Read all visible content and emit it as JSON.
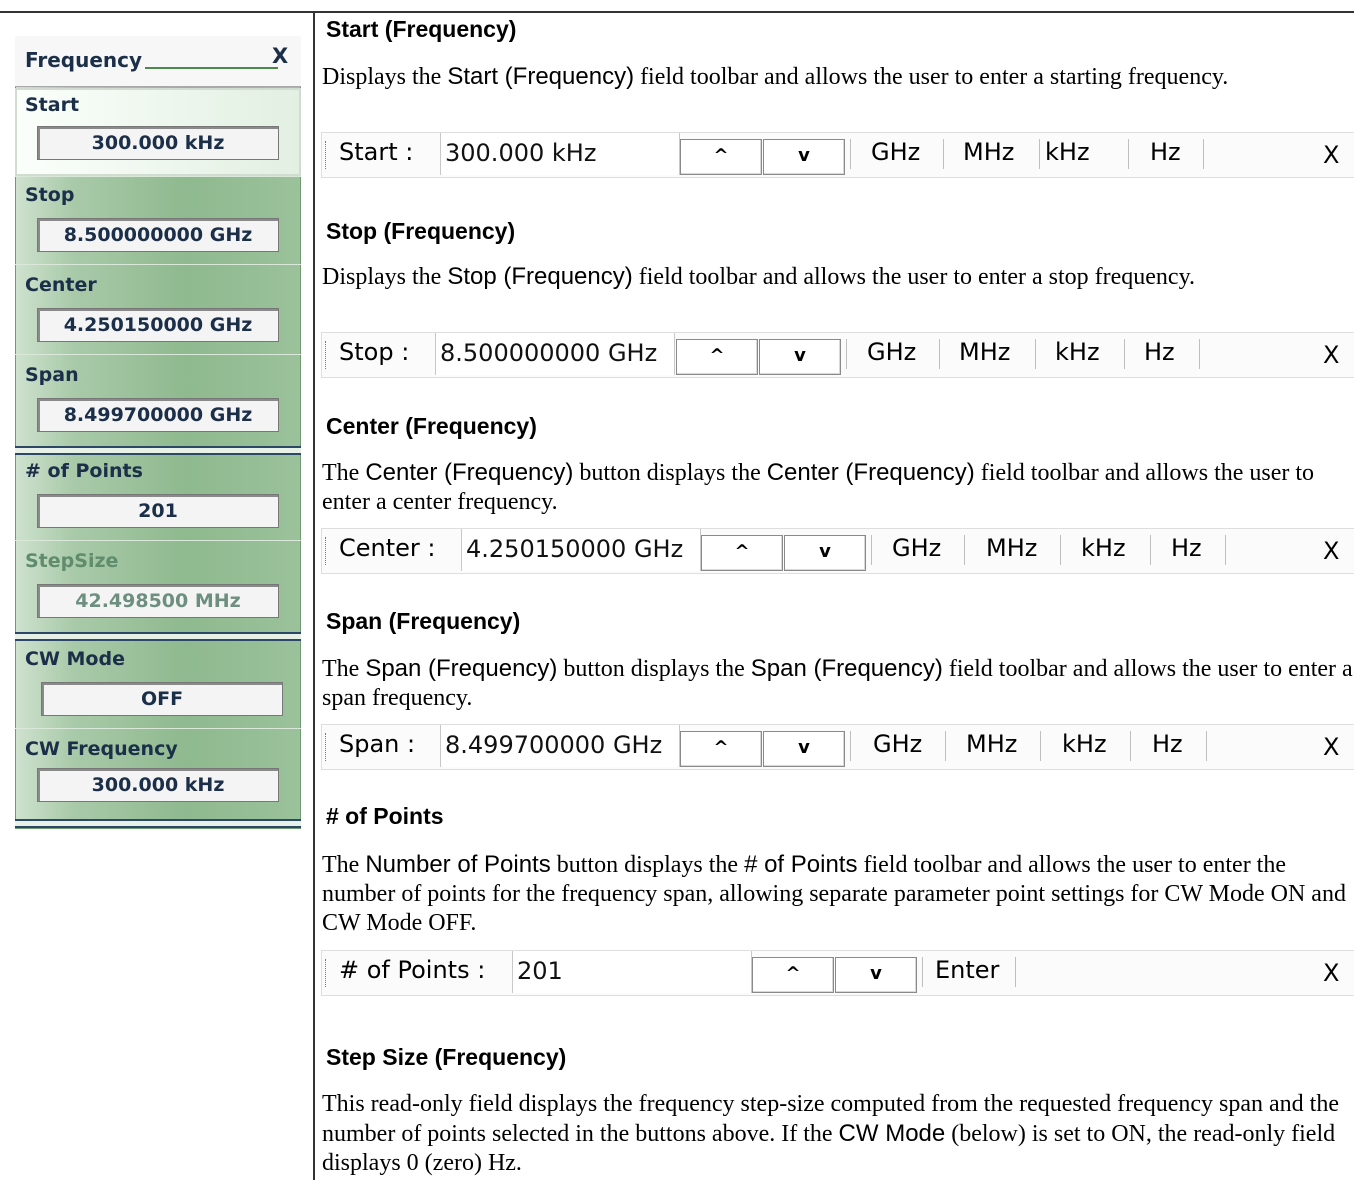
{
  "menu": {
    "title": "Frequency",
    "close_label": "X",
    "items": [
      {
        "label": "Start",
        "value": "300.000 kHz"
      },
      {
        "label": "Stop",
        "value": "8.500000000 GHz"
      },
      {
        "label": "Center",
        "value": "4.250150000 GHz"
      },
      {
        "label": "Span",
        "value": "8.499700000 GHz"
      },
      {
        "label": "# of Points",
        "value": "201"
      },
      {
        "label": "StepSize",
        "value": "42.498500 MHz"
      },
      {
        "label": "CW Mode",
        "value": "OFF"
      },
      {
        "label": "CW Frequency",
        "value": "300.000 kHz"
      }
    ]
  },
  "sections": {
    "start": {
      "heading": "Start (Frequency)",
      "p1": "Displays the ",
      "k1": "Start (Frequency)",
      "p2": " field toolbar and allows the user to enter a starting frequency."
    },
    "stop": {
      "heading": "Stop (Frequency)",
      "p1": "Displays the ",
      "k1": "Stop (Frequency)",
      "p2": " field toolbar and allows the user to enter a stop frequency."
    },
    "center": {
      "heading": "Center (Frequency)",
      "p1": "The ",
      "k1": "Center (Frequency)",
      "p2": " button displays the ",
      "k2": "Center (Frequency)",
      "p3": " field toolbar and allows the user to enter a center frequency."
    },
    "span": {
      "heading": "Span (Frequency)",
      "p1": "The ",
      "k1": "Span (Frequency)",
      "p2": " button displays the ",
      "k2": "Span (Frequency)",
      "p3": " field toolbar and allows the user to enter a span frequency."
    },
    "points": {
      "heading": "# of Points",
      "p1": "The ",
      "k1": "Number of Points",
      "p2": " button displays the ",
      "k2": "# of Points",
      "p3": " field toolbar and allows the user to enter the number of points for the frequency span, allowing separate parameter point settings for CW Mode ON and CW Mode OFF."
    },
    "stepsize": {
      "heading": "Step Size (Frequency)",
      "p1": "This read-only field displays the frequency step-size computed from the requested frequency span and the number of points selected in the buttons above. If the ",
      "k1": "CW Mode",
      "p2": " (below) is set to ON, the read-only field displays 0 (zero) Hz."
    }
  },
  "toolbars": {
    "start": {
      "label": "Start :",
      "value": "300.000 kHz"
    },
    "stop": {
      "label": "Stop :",
      "value": "8.500000000 GHz"
    },
    "center": {
      "label": "Center :",
      "value": "4.250150000 GHz"
    },
    "span": {
      "label": "Span :",
      "value": "8.499700000 GHz"
    },
    "points": {
      "label": "# of Points :",
      "value": "201",
      "enter": "Enter"
    },
    "up": "^",
    "down": "v",
    "units": [
      "GHz",
      "MHz",
      "kHz",
      "Hz"
    ],
    "close": "X"
  }
}
